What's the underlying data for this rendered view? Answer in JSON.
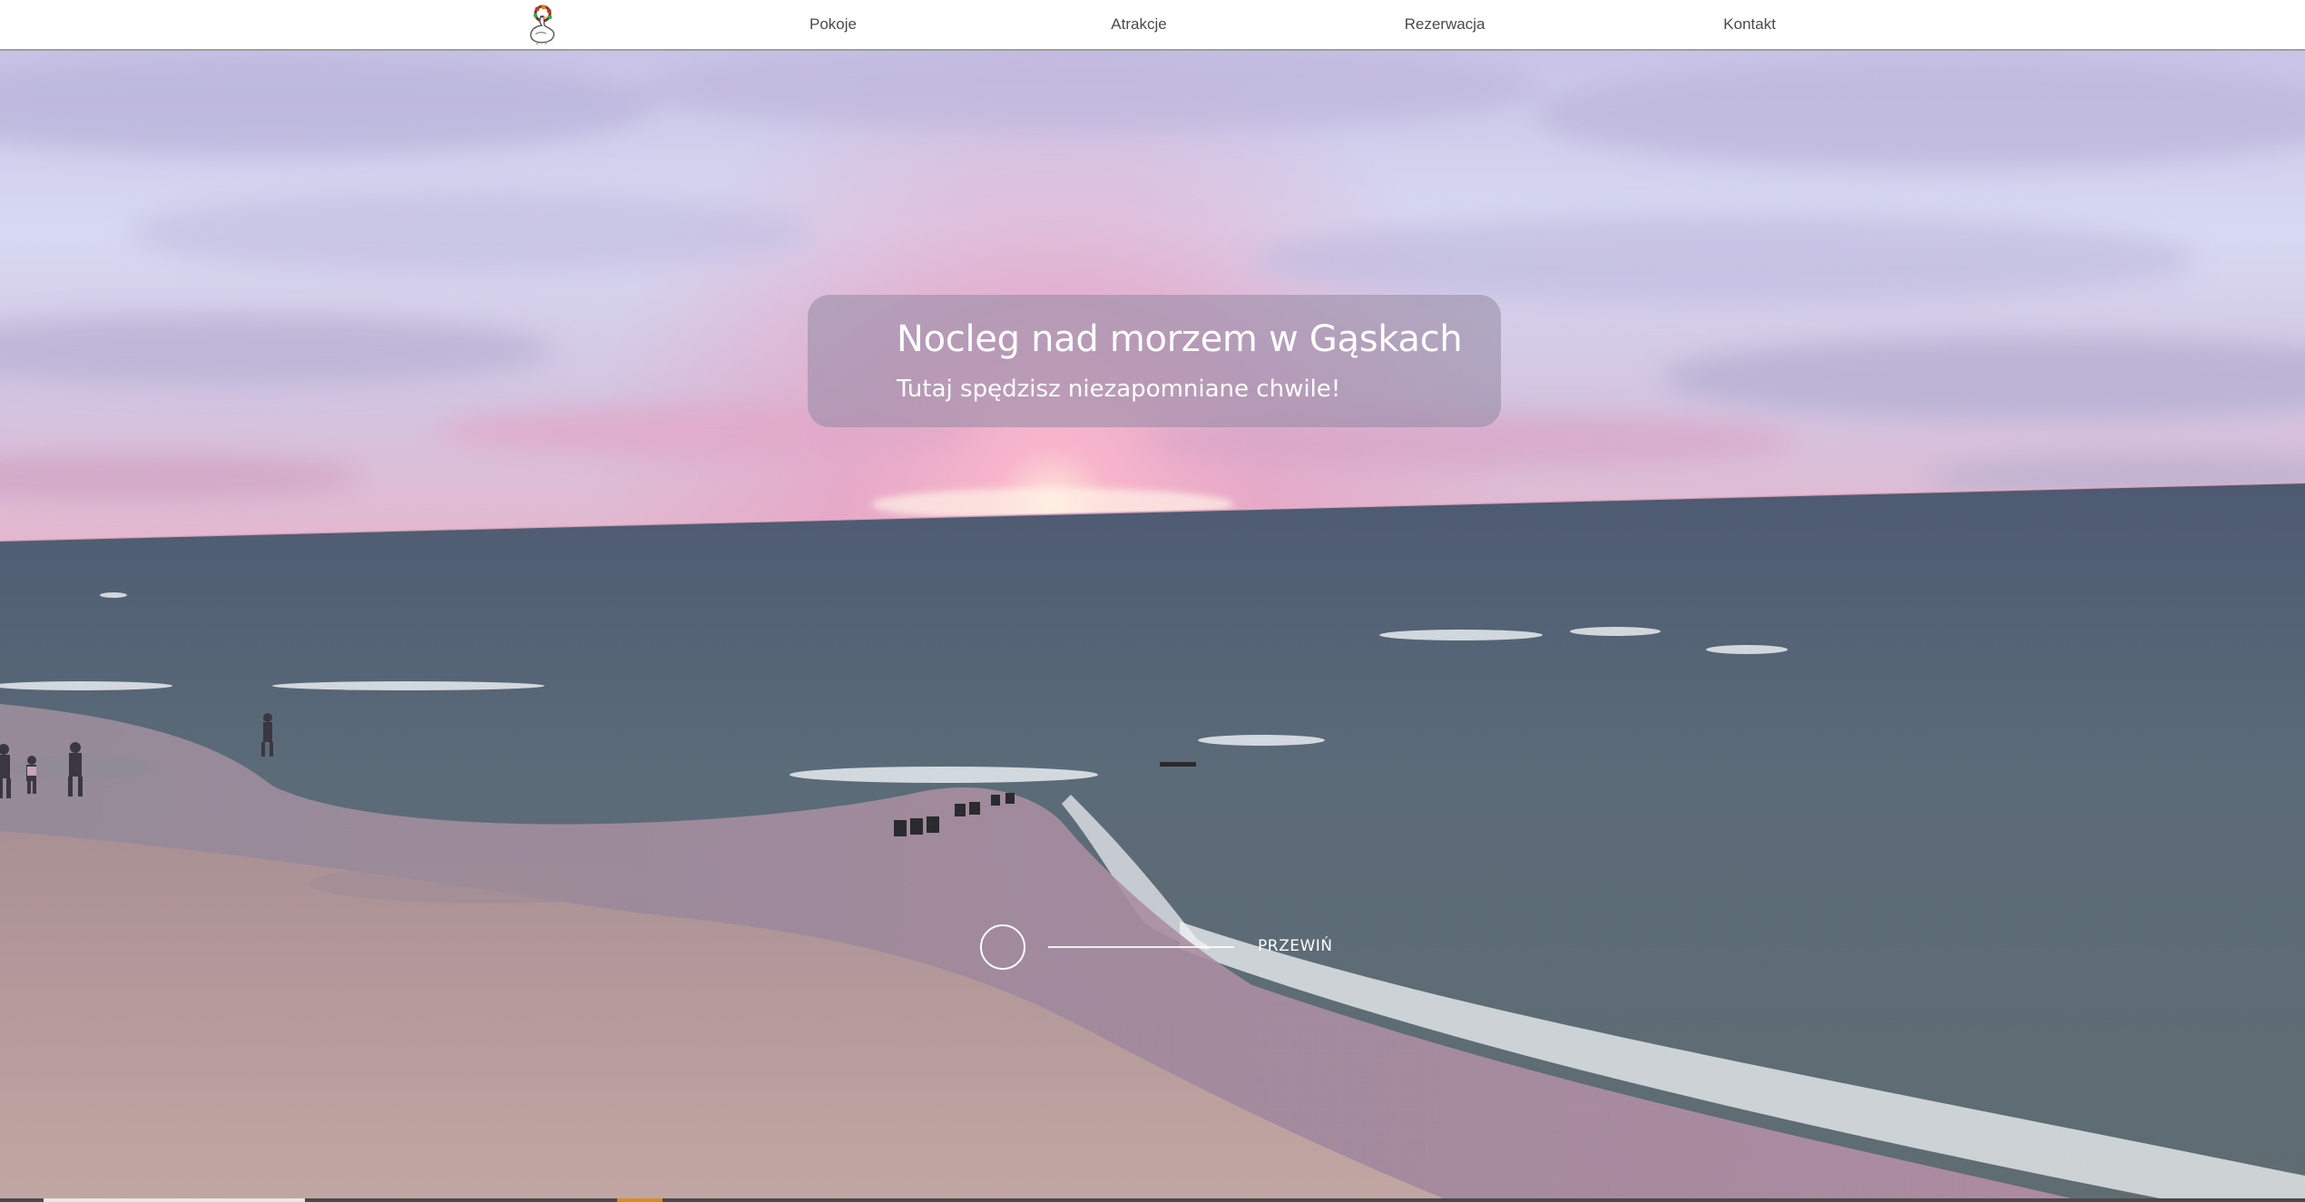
{
  "nav": {
    "logo_icon": "goose-logo-icon",
    "items": [
      {
        "label": "Pokoje"
      },
      {
        "label": "Atrakcje"
      },
      {
        "label": "Rezerwacja"
      },
      {
        "label": "Kontakt"
      }
    ]
  },
  "hero": {
    "title": "Nocleg nad morzem w Gąskach",
    "subtitle": "Tutaj spędzisz niezapomniane chwile!",
    "scroll_label": "PRZEWIŃ",
    "scroll_icon": "scroll-circle-icon"
  },
  "colors": {
    "nav_bg": "#ffffff",
    "nav_text": "#4a4a4a",
    "sky_top": "#d9dcf2",
    "sunset_pink": "#f2a6c4",
    "sea": "#536577",
    "sand": "#b89a9a",
    "card_bg": "#968ca5",
    "accent": "#d88a2a"
  }
}
